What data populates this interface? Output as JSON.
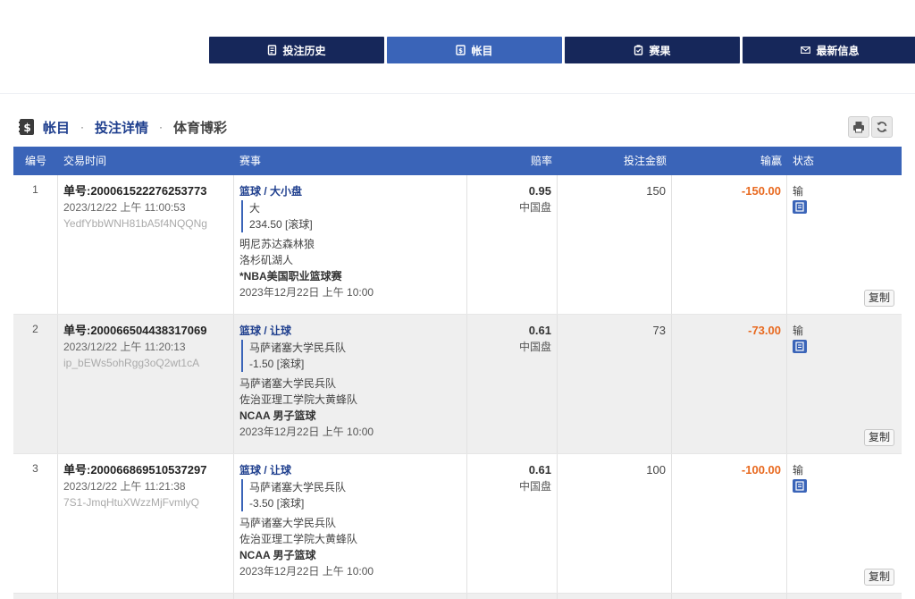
{
  "nav": {
    "items": [
      {
        "label": "投注历史",
        "icon": "receipt-icon",
        "active": false
      },
      {
        "label": "帐目",
        "icon": "ledger-icon",
        "active": true
      },
      {
        "label": "赛果",
        "icon": "results-icon",
        "active": false
      },
      {
        "label": "最新信息",
        "icon": "mail-icon",
        "active": false
      }
    ]
  },
  "breadcrumb": {
    "a": "帐目",
    "b": "投注详情",
    "c": "体育博彩",
    "sep": "·"
  },
  "colors": {
    "navy": "#16275a",
    "accent": "#3a64b8",
    "loss": "#e8691f"
  },
  "table": {
    "headers": [
      "编号",
      "交易时间",
      "赛事",
      "赔率",
      "投注金额",
      "输赢",
      "状态"
    ],
    "copy_label": "复制",
    "rows": [
      {
        "no": "1",
        "ticket": "单号:200061522276253773",
        "time": "2023/12/22 上午 11:00:53",
        "ref": "YedfYbbWNH81bA5f4NQQNg",
        "sport": "篮球 / 大小盘",
        "pick": "大",
        "line": "234.50 [滚球]",
        "home": "明尼苏达森林狼",
        "away": "洛杉矶湖人",
        "league": "*NBA美国职业篮球赛",
        "start": "2023年12月22日 上午 10:00",
        "odds": "0.95",
        "odds_type": "中国盘",
        "stake": "150",
        "win_loss": "-150.00",
        "status": "输"
      },
      {
        "no": "2",
        "ticket": "单号:200066504438317069",
        "time": "2023/12/22 上午 11:20:13",
        "ref": "ip_bEWs5ohRgg3oQ2wt1cA",
        "sport": "篮球 / 让球",
        "pick": "马萨诸塞大学民兵队",
        "line": "-1.50 [滚球]",
        "home": "马萨诸塞大学民兵队",
        "away": "佐治亚理工学院大黄蜂队",
        "league": "NCAA 男子篮球",
        "start": "2023年12月22日 上午 10:00",
        "odds": "0.61",
        "odds_type": "中国盘",
        "stake": "73",
        "win_loss": "-73.00",
        "status": "输"
      },
      {
        "no": "3",
        "ticket": "单号:200066869510537297",
        "time": "2023/12/22 上午 11:21:38",
        "ref": "7S1-JmqHtuXWzzMjFvmlyQ",
        "sport": "篮球 / 让球",
        "pick": "马萨诸塞大学民兵队",
        "line": "-3.50 [滚球]",
        "home": "马萨诸塞大学民兵队",
        "away": "佐治亚理工学院大黄蜂队",
        "league": "NCAA 男子篮球",
        "start": "2023年12月22日 上午 10:00",
        "odds": "0.61",
        "odds_type": "中国盘",
        "stake": "100",
        "win_loss": "-100.00",
        "status": "输"
      }
    ]
  }
}
